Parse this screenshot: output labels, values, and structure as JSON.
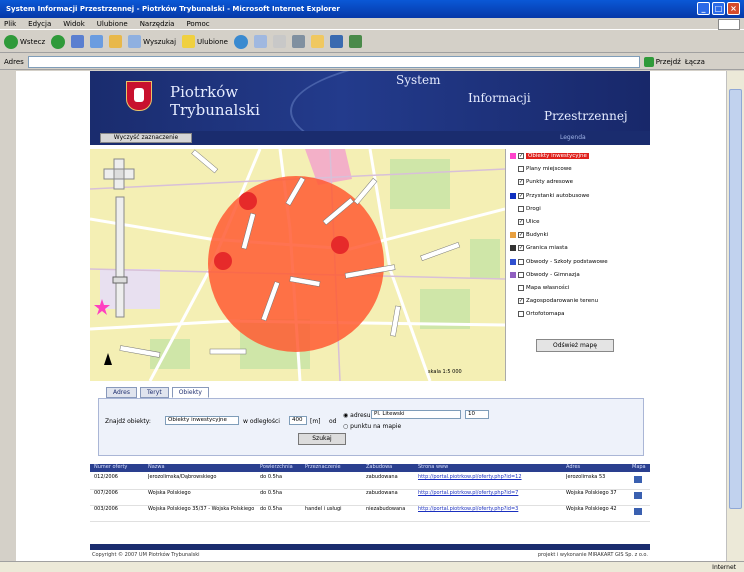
{
  "window": {
    "title": "System Informacji Przestrzennej - Piotrków Trybunalski - Microsoft Internet Explorer"
  },
  "menu": [
    "Plik",
    "Edycja",
    "Widok",
    "Ulubione",
    "Narzędzia",
    "Pomoc"
  ],
  "toolbar": {
    "back": "Wstecz",
    "search": "Wyszukaj",
    "favorites": "Ulubione"
  },
  "address": {
    "label": "Adres",
    "go": "Przejdź",
    "links": "Łącza"
  },
  "header": {
    "city_line1": "Piotrków",
    "city_line2": "Trybunalski",
    "sys1": "System",
    "sys2": "Informacji",
    "sys3": "Przestrzennej"
  },
  "subbar": {
    "clear_button": "Wyczyść zaznaczenie",
    "legend_link": "Legenda"
  },
  "map": {
    "scale_label": "skala 1:5 000"
  },
  "layers": [
    {
      "label": "Obiekty inwestycyjne",
      "checked": true,
      "icon_color": "#ff44cc",
      "highlight": true
    },
    {
      "label": "Plany miejscowe",
      "checked": false,
      "icon_color": "",
      "highlight": false
    },
    {
      "label": "Punkty adresowe",
      "checked": true,
      "icon_color": "",
      "highlight": false
    },
    {
      "label": "Przystanki autobusowe",
      "checked": true,
      "icon_color": "#1030c0",
      "highlight": false
    },
    {
      "label": "Drogi",
      "checked": false,
      "icon_color": "",
      "highlight": false
    },
    {
      "label": "Ulice",
      "checked": true,
      "icon_color": "",
      "highlight": false
    },
    {
      "label": "Budynki",
      "checked": true,
      "icon_color": "#e8a040",
      "highlight": false
    },
    {
      "label": "Granica miasta",
      "checked": true,
      "icon_color": "#333333",
      "highlight": false
    },
    {
      "label": "Obwody - Szkoły podstawowe",
      "checked": false,
      "icon_color": "#3050d0",
      "highlight": false
    },
    {
      "label": "Obwody - Gimnazja",
      "checked": false,
      "icon_color": "#9060c0",
      "highlight": false
    },
    {
      "label": "Mapa własności",
      "checked": false,
      "icon_color": "",
      "highlight": false
    },
    {
      "label": "Zagospodarowanie terenu",
      "checked": true,
      "icon_color": "",
      "highlight": false
    },
    {
      "label": "Ortofotomapa",
      "checked": false,
      "icon_color": "",
      "highlight": false
    }
  ],
  "show_map_button": "Odśwież mapę",
  "tabs": [
    "Adres",
    "Teryt",
    "Obiekty"
  ],
  "search_form": {
    "label": "Znajdź obiekty:",
    "type_value": "Obiekty inwestycyjne",
    "radius_label": "w odległości",
    "radius_value": "400",
    "unit": "[m]",
    "from": "od",
    "opt_address": "adresu",
    "street_value": "Pl. Litewski",
    "number_value": "10",
    "opt_point": "punktu na mapie",
    "search_button": "Szukaj"
  },
  "results": {
    "headers": [
      "Numer oferty",
      "Nazwa",
      "Powierzchnia",
      "Przeznaczenie",
      "Zabudowa",
      "Strona www",
      "Adres",
      "Mapa"
    ],
    "rows": [
      [
        "012/2006",
        "Jerozolimska/Dąbrowskiego",
        "do 0.5ha",
        "",
        "zabudowana",
        "http://portal.piotrkow.pl/oferty.php?id=12",
        "Jerozolimska 53"
      ],
      [
        "007/2006",
        "Wojska Polskiego",
        "do 0.5ha",
        "",
        "zabudowana",
        "http://portal.piotrkow.pl/oferty.php?id=7",
        "Wojska Polskiego 37"
      ],
      [
        "003/2006",
        "Wojska Polskiego 35/37 - Wojska Polskiego",
        "do 0.5ha",
        "handel i usługi",
        "niezabudowana",
        "http://portal.piotrkow.pl/oferty.php?id=3",
        "Wojska Polskiego 42"
      ]
    ]
  },
  "footer": {
    "left": "Copyright © 2007 UM Piotrków Trybunalski",
    "right": "projekt i wykonanie MIRAKART GIS Sp. z o.o."
  },
  "status": {
    "zone": "Internet"
  }
}
